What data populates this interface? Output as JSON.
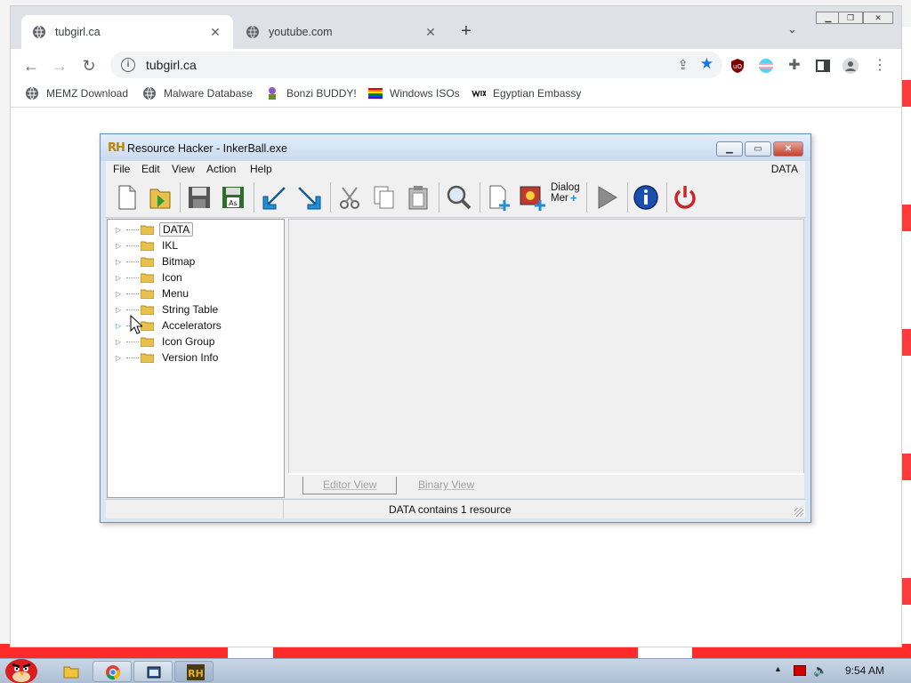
{
  "browser": {
    "tabs": [
      {
        "title": "tubgirl.ca",
        "active": true
      },
      {
        "title": "youtube.com",
        "active": false
      }
    ],
    "new_tab": "+",
    "url": "tubgirl.ca",
    "bookmarks": [
      {
        "label": "MEMZ Download",
        "icon": "globe-icon"
      },
      {
        "label": "Malware Database",
        "icon": "globe-icon"
      },
      {
        "label": "Bonzi BUDDY!",
        "icon": "bonzi-icon"
      },
      {
        "label": "Windows ISOs",
        "icon": "rainbow-flag-icon"
      },
      {
        "label": "Egyptian Embassy",
        "icon": "wix-icon"
      }
    ]
  },
  "rh": {
    "title": "Resource Hacker - InkerBall.exe",
    "logo": "RH",
    "menus": [
      "File",
      "Edit",
      "View",
      "Action",
      "Help"
    ],
    "menu_right": "DATA",
    "tree": [
      {
        "label": "DATA",
        "selected": true
      },
      {
        "label": "IKL"
      },
      {
        "label": "Bitmap"
      },
      {
        "label": "Icon"
      },
      {
        "label": "Menu"
      },
      {
        "label": "String Table"
      },
      {
        "label": "Accelerators"
      },
      {
        "label": "Icon Group"
      },
      {
        "label": "Version Info"
      }
    ],
    "view_tabs": [
      "Editor View",
      "Binary View"
    ],
    "status": "DATA contains 1 resource",
    "dialog_tool_label_1": "Dialog",
    "dialog_tool_label_2": "Mer"
  },
  "taskbar": {
    "clock": "9:54 AM",
    "colors": {
      "accent": "#1a73e8",
      "close_red": "#c5432c"
    }
  }
}
